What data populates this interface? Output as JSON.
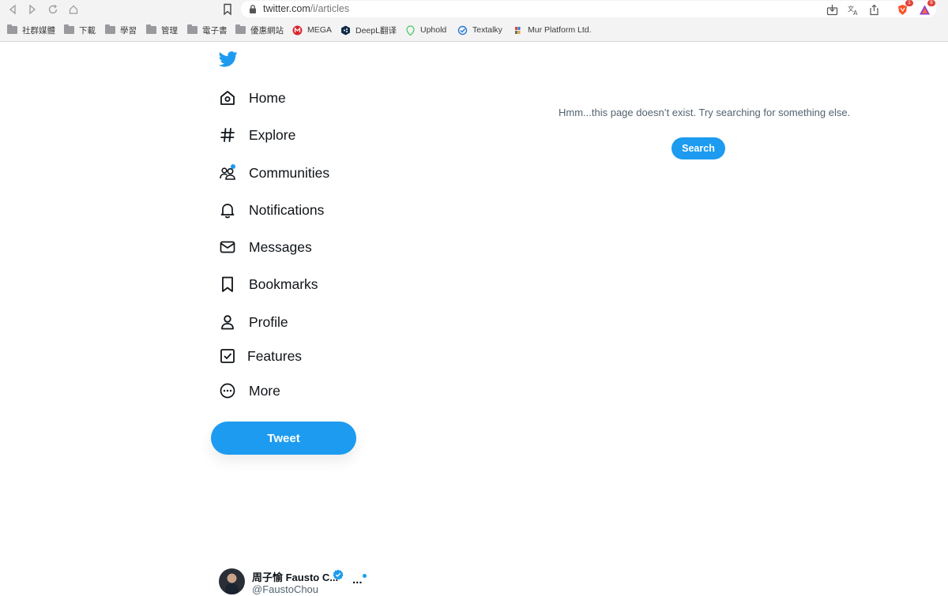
{
  "browser": {
    "url_host": "twitter.com",
    "url_path": "/i/articles",
    "extension_badges": {
      "brave": "1",
      "vpn": "6"
    }
  },
  "bookmarks": [
    {
      "label": "社群媒體",
      "icon": "folder-icon"
    },
    {
      "label": "下載",
      "icon": "folder-icon"
    },
    {
      "label": "學習",
      "icon": "folder-icon"
    },
    {
      "label": "管理",
      "icon": "folder-icon"
    },
    {
      "label": "電子書",
      "icon": "folder-icon"
    },
    {
      "label": "優惠網站",
      "icon": "folder-icon"
    },
    {
      "label": "MEGA",
      "icon": "mega-icon"
    },
    {
      "label": "DeepL翻译",
      "icon": "deepl-icon"
    },
    {
      "label": "Uphold",
      "icon": "uphold-icon"
    },
    {
      "label": "Textalky",
      "icon": "textalky-icon"
    },
    {
      "label": "Mur Platform Ltd.",
      "icon": "mur-icon"
    }
  ],
  "sidebar": {
    "items": [
      {
        "label": "Home",
        "icon": "home-icon"
      },
      {
        "label": "Explore",
        "icon": "hashtag-icon"
      },
      {
        "label": "Communities",
        "icon": "communities-icon"
      },
      {
        "label": "Notifications",
        "icon": "bell-icon"
      },
      {
        "label": "Messages",
        "icon": "envelope-icon"
      },
      {
        "label": "Bookmarks",
        "icon": "bookmark-icon"
      },
      {
        "label": "Profile",
        "icon": "person-icon"
      },
      {
        "label": "Features",
        "icon": "checkbox-icon"
      },
      {
        "label": "More",
        "icon": "more-circle-icon"
      }
    ],
    "tweet_label": "Tweet"
  },
  "profile": {
    "name": "周子愉 Fausto C...",
    "handle": "@FaustoChou",
    "more": "..."
  },
  "main": {
    "message": "Hmm...this page doesn’t exist. Try searching for something else.",
    "search_label": "Search"
  },
  "colors": {
    "accent": "#1d9bf0",
    "text": "#0f1419",
    "secondary_text": "#536471"
  }
}
